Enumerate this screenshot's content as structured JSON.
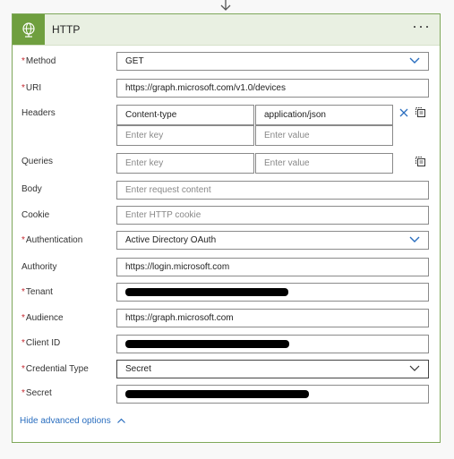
{
  "card": {
    "title": "HTTP",
    "more_label": "···"
  },
  "fields": {
    "method": {
      "label": "Method",
      "value": "GET"
    },
    "uri": {
      "label": "URI",
      "value": "https://graph.microsoft.com/v1.0/devices"
    },
    "headers": {
      "label": "Headers",
      "rows": [
        {
          "key": "Content-type",
          "value": "application/json"
        }
      ],
      "key_placeholder": "Enter key",
      "value_placeholder": "Enter value"
    },
    "queries": {
      "label": "Queries",
      "key_placeholder": "Enter key",
      "value_placeholder": "Enter value"
    },
    "body": {
      "label": "Body",
      "placeholder": "Enter request content"
    },
    "cookie": {
      "label": "Cookie",
      "placeholder": "Enter HTTP cookie"
    },
    "authentication": {
      "label": "Authentication",
      "value": "Active Directory OAuth"
    },
    "authority": {
      "label": "Authority",
      "value": "https://login.microsoft.com"
    },
    "tenant": {
      "label": "Tenant"
    },
    "audience": {
      "label": "Audience",
      "value": "https://graph.microsoft.com"
    },
    "client_id": {
      "label": "Client ID"
    },
    "credential_type": {
      "label": "Credential Type",
      "value": "Secret"
    },
    "secret": {
      "label": "Secret"
    }
  },
  "advanced_toggle": "Hide advanced options",
  "colors": {
    "accent": "#6f9f3f",
    "header_bg": "#e9f0e2",
    "required": "#c4262e",
    "link": "#2a6ebf",
    "dropdown_chevron": "#2a6ebf"
  }
}
